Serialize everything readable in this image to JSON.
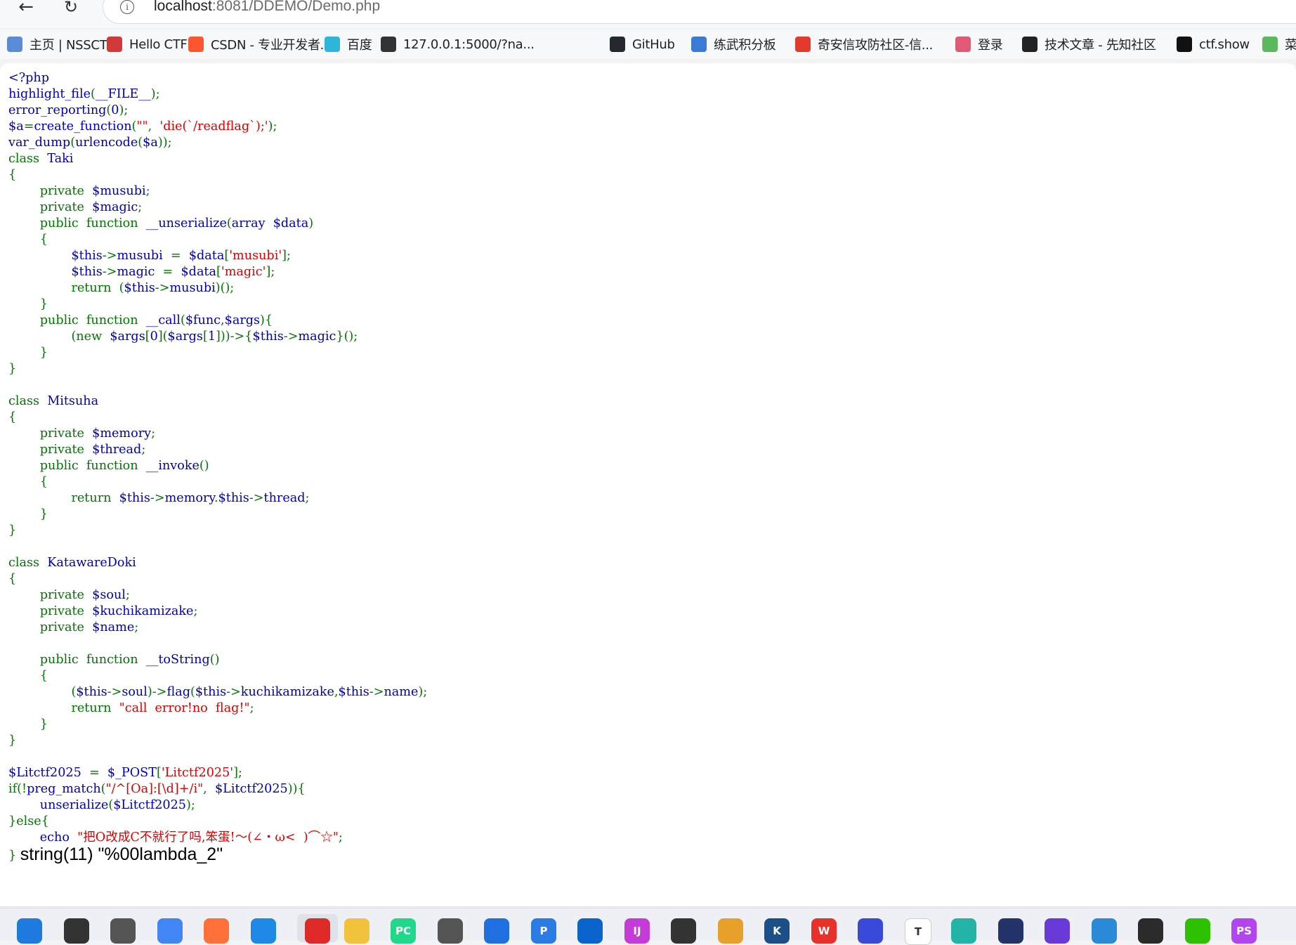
{
  "browser": {
    "url_host": "localhost",
    "url_path": ":8081/DDEMO/Demo.php",
    "bookmarks": [
      {
        "label": "主页 | NSSCTF",
        "icon": "nssctf-icon",
        "color": "#5b8bd6"
      },
      {
        "label": "Hello CTF",
        "icon": "hello-ctf-icon",
        "color": "#d03a3a"
      },
      {
        "label": "CSDN - 专业开发者...",
        "icon": "csdn-icon",
        "color": "#fc5531"
      },
      {
        "label": "百度",
        "icon": "baidu-icon",
        "color": "#2fb5d9"
      },
      {
        "label": "127.0.0.1:5000/?na...",
        "icon": "globe-icon",
        "color": "#333333"
      },
      {
        "label": "GitHub",
        "icon": "github-icon",
        "color": "#24292f"
      },
      {
        "label": "练武积分板",
        "icon": "scoreboard-icon",
        "color": "#3a7bd5"
      },
      {
        "label": "奇安信攻防社区-信...",
        "icon": "qianxin-icon",
        "color": "#e23b2e"
      },
      {
        "label": "登录",
        "icon": "login-icon",
        "color": "#e05a78"
      },
      {
        "label": "技术文章 - 先知社区",
        "icon": "xianzhi-icon",
        "color": "#222222"
      },
      {
        "label": "ctf.show",
        "icon": "ctfshow-icon",
        "color": "#111111"
      },
      {
        "label": "菜",
        "icon": "runoob-icon",
        "color": "#5cb85c"
      }
    ]
  },
  "code_lines": [
    [
      [
        "<?php",
        "df"
      ]
    ],
    [
      [
        "highlight_file",
        "df"
      ],
      [
        "(",
        "kw"
      ],
      [
        "__FILE__",
        "df"
      ],
      [
        ");",
        "kw"
      ]
    ],
    [
      [
        "error_reporting",
        "df"
      ],
      [
        "(",
        "kw"
      ],
      [
        "0",
        "df"
      ],
      [
        ");",
        "kw"
      ]
    ],
    [
      [
        "$a",
        "df"
      ],
      [
        "=",
        "kw"
      ],
      [
        "create_function",
        "df"
      ],
      [
        "(",
        "kw"
      ],
      [
        "\"\"",
        "st"
      ],
      [
        ",  ",
        "kw"
      ],
      [
        "'die(`/readflag`);'",
        "st"
      ],
      [
        ");",
        "kw"
      ]
    ],
    [
      [
        "var_dump",
        "df"
      ],
      [
        "(",
        "kw"
      ],
      [
        "urlencode",
        "df"
      ],
      [
        "(",
        "kw"
      ],
      [
        "$a",
        "df"
      ],
      [
        "));",
        "kw"
      ]
    ],
    [
      [
        "class  ",
        "kw"
      ],
      [
        "Taki",
        "df"
      ]
    ],
    [
      [
        "{",
        "kw"
      ]
    ],
    [
      [
        "        private  ",
        "kw"
      ],
      [
        "$musubi",
        "df"
      ],
      [
        ";",
        "kw"
      ]
    ],
    [
      [
        "        private  ",
        "kw"
      ],
      [
        "$magic",
        "df"
      ],
      [
        ";",
        "kw"
      ]
    ],
    [
      [
        "        public  function  ",
        "kw"
      ],
      [
        "__unserialize",
        "df"
      ],
      [
        "(",
        "kw"
      ],
      [
        "array  ",
        "df"
      ],
      [
        "$data",
        "df"
      ],
      [
        ")",
        "kw"
      ]
    ],
    [
      [
        "        {",
        "kw"
      ]
    ],
    [
      [
        "                ",
        "kw"
      ],
      [
        "$this",
        "df"
      ],
      [
        "->",
        "kw"
      ],
      [
        "musubi  ",
        "df"
      ],
      [
        "=  ",
        "kw"
      ],
      [
        "$data",
        "df"
      ],
      [
        "[",
        "kw"
      ],
      [
        "'musubi'",
        "st"
      ],
      [
        "];",
        "kw"
      ]
    ],
    [
      [
        "                ",
        "kw"
      ],
      [
        "$this",
        "df"
      ],
      [
        "->",
        "kw"
      ],
      [
        "magic  ",
        "df"
      ],
      [
        "=  ",
        "kw"
      ],
      [
        "$data",
        "df"
      ],
      [
        "[",
        "kw"
      ],
      [
        "'magic'",
        "st"
      ],
      [
        "];",
        "kw"
      ]
    ],
    [
      [
        "                return  (",
        "kw"
      ],
      [
        "$this",
        "df"
      ],
      [
        "->",
        "kw"
      ],
      [
        "musubi",
        "df"
      ],
      [
        ")();",
        "kw"
      ]
    ],
    [
      [
        "        }",
        "kw"
      ]
    ],
    [
      [
        "        public  function  ",
        "kw"
      ],
      [
        "__call",
        "df"
      ],
      [
        "(",
        "kw"
      ],
      [
        "$func",
        "df"
      ],
      [
        ",",
        "kw"
      ],
      [
        "$args",
        "df"
      ],
      [
        "){",
        "kw"
      ]
    ],
    [
      [
        "                (new  ",
        "kw"
      ],
      [
        "$args",
        "df"
      ],
      [
        "[",
        "kw"
      ],
      [
        "0",
        "df"
      ],
      [
        "](",
        "kw"
      ],
      [
        "$args",
        "df"
      ],
      [
        "[",
        "kw"
      ],
      [
        "1",
        "df"
      ],
      [
        "]))->{",
        "kw"
      ],
      [
        "$this",
        "df"
      ],
      [
        "->",
        "kw"
      ],
      [
        "magic",
        "df"
      ],
      [
        "}();",
        "kw"
      ]
    ],
    [
      [
        "        }",
        "kw"
      ]
    ],
    [
      [
        "}",
        "kw"
      ]
    ],
    [
      [
        "",
        "kw"
      ]
    ],
    [
      [
        "class  ",
        "kw"
      ],
      [
        "Mitsuha",
        "df"
      ]
    ],
    [
      [
        "{",
        "kw"
      ]
    ],
    [
      [
        "        private  ",
        "kw"
      ],
      [
        "$memory",
        "df"
      ],
      [
        ";",
        "kw"
      ]
    ],
    [
      [
        "        private  ",
        "kw"
      ],
      [
        "$thread",
        "df"
      ],
      [
        ";",
        "kw"
      ]
    ],
    [
      [
        "        public  function  ",
        "kw"
      ],
      [
        "__invoke",
        "df"
      ],
      [
        "()",
        "kw"
      ]
    ],
    [
      [
        "        {",
        "kw"
      ]
    ],
    [
      [
        "                return  ",
        "kw"
      ],
      [
        "$this",
        "df"
      ],
      [
        "->",
        "kw"
      ],
      [
        "memory",
        "df"
      ],
      [
        ".",
        "kw"
      ],
      [
        "$this",
        "df"
      ],
      [
        "->",
        "kw"
      ],
      [
        "thread",
        "df"
      ],
      [
        ";",
        "kw"
      ]
    ],
    [
      [
        "        }",
        "kw"
      ]
    ],
    [
      [
        "}",
        "kw"
      ]
    ],
    [
      [
        "",
        "kw"
      ]
    ],
    [
      [
        "class  ",
        "kw"
      ],
      [
        "KatawareDoki",
        "df"
      ]
    ],
    [
      [
        "{",
        "kw"
      ]
    ],
    [
      [
        "        private  ",
        "kw"
      ],
      [
        "$soul",
        "df"
      ],
      [
        ";",
        "kw"
      ]
    ],
    [
      [
        "        private  ",
        "kw"
      ],
      [
        "$kuchikamizake",
        "df"
      ],
      [
        ";",
        "kw"
      ]
    ],
    [
      [
        "        private  ",
        "kw"
      ],
      [
        "$name",
        "df"
      ],
      [
        ";",
        "kw"
      ]
    ],
    [
      [
        "",
        "kw"
      ]
    ],
    [
      [
        "        public  function  ",
        "kw"
      ],
      [
        "__toString",
        "df"
      ],
      [
        "()",
        "kw"
      ]
    ],
    [
      [
        "        {",
        "kw"
      ]
    ],
    [
      [
        "                (",
        "kw"
      ],
      [
        "$this",
        "df"
      ],
      [
        "->",
        "kw"
      ],
      [
        "soul",
        "df"
      ],
      [
        ")->",
        "kw"
      ],
      [
        "flag",
        "df"
      ],
      [
        "(",
        "kw"
      ],
      [
        "$this",
        "df"
      ],
      [
        "->",
        "kw"
      ],
      [
        "kuchikamizake",
        "df"
      ],
      [
        ",",
        "kw"
      ],
      [
        "$this",
        "df"
      ],
      [
        "->",
        "kw"
      ],
      [
        "name",
        "df"
      ],
      [
        ");",
        "kw"
      ]
    ],
    [
      [
        "                return  ",
        "kw"
      ],
      [
        "\"call  error!no  flag!\"",
        "st"
      ],
      [
        ";",
        "kw"
      ]
    ],
    [
      [
        "        }",
        "kw"
      ]
    ],
    [
      [
        "}",
        "kw"
      ]
    ],
    [
      [
        "",
        "kw"
      ]
    ],
    [
      [
        "$Litctf2025  ",
        "df"
      ],
      [
        "=  ",
        "kw"
      ],
      [
        "$_POST",
        "df"
      ],
      [
        "[",
        "kw"
      ],
      [
        "'Litctf2025'",
        "st"
      ],
      [
        "];",
        "kw"
      ]
    ],
    [
      [
        "if(!",
        "kw"
      ],
      [
        "preg_match",
        "df"
      ],
      [
        "(",
        "kw"
      ],
      [
        "\"/^[Oa]:[\\d]+/i\"",
        "st"
      ],
      [
        ",  ",
        "kw"
      ],
      [
        "$Litctf2025",
        "df"
      ],
      [
        "))",
        "kw"
      ],
      [
        "{",
        "kw"
      ]
    ],
    [
      [
        "        ",
        "kw"
      ],
      [
        "unserialize",
        "df"
      ],
      [
        "(",
        "kw"
      ],
      [
        "$Litctf2025",
        "df"
      ],
      [
        ");",
        "kw"
      ]
    ],
    [
      [
        "}else{",
        "kw"
      ]
    ],
    [
      [
        "        echo  ",
        "df"
      ],
      [
        "\"把O改成C不就行了吗,笨蛋!～(∠・ω<  )⌒☆\"",
        "st"
      ],
      [
        ";",
        "kw"
      ]
    ],
    [
      [
        "} ",
        "kw"
      ]
    ]
  ],
  "var_dump_output": "string(11) \"%00lambda_2\"",
  "taskbar": [
    {
      "icon": "windows-start-icon",
      "color": "#1f7ae0",
      "label": ""
    },
    {
      "icon": "search-icon",
      "color": "#333333",
      "label": ""
    },
    {
      "icon": "task-view-icon",
      "color": "#555555",
      "label": ""
    },
    {
      "icon": "chrome-icon",
      "color": "#4285f4",
      "label": ""
    },
    {
      "icon": "firefox-icon",
      "color": "#ff7139",
      "label": ""
    },
    {
      "icon": "vscode-icon",
      "color": "#1e88e5",
      "label": ""
    },
    {
      "icon": "netease-music-icon",
      "color": "#e02a2a",
      "label": ""
    },
    {
      "icon": "file-explorer-icon",
      "color": "#f2c23c",
      "label": ""
    },
    {
      "icon": "pycharm-icon",
      "color": "#21d789",
      "label": "PC"
    },
    {
      "icon": "burp-icon",
      "color": "#555555",
      "label": ""
    },
    {
      "icon": "feishu-icon",
      "color": "#1f6fe0",
      "label": ""
    },
    {
      "icon": "p-app-icon",
      "color": "#2a7be4",
      "label": "P"
    },
    {
      "icon": "edge-blue-icon",
      "color": "#0b63ce",
      "label": ""
    },
    {
      "icon": "intellij-icon",
      "color": "#c43bd8",
      "label": "IJ"
    },
    {
      "icon": "penguin-icon",
      "color": "#333333",
      "label": ""
    },
    {
      "icon": "wireshark-icon",
      "color": "#e8a02a",
      "label": ""
    },
    {
      "icon": "k-app-icon",
      "color": "#1b4f86",
      "label": "K"
    },
    {
      "icon": "wps-icon",
      "color": "#e8312a",
      "label": "W"
    },
    {
      "icon": "headphones-icon",
      "color": "#3a4ad8",
      "label": ""
    },
    {
      "icon": "typora-icon",
      "color": "#ffffff",
      "label": "T"
    },
    {
      "icon": "edge-icon",
      "color": "#23b3a7",
      "label": ""
    },
    {
      "icon": "cat-icon",
      "color": "#24336a",
      "label": ""
    },
    {
      "icon": "bolt-app-icon",
      "color": "#6a3ad8",
      "label": ""
    },
    {
      "icon": "vmware-icon",
      "color": "#2a8ad8",
      "label": ""
    },
    {
      "icon": "terminal-icon",
      "color": "#2b2b2b",
      "label": ""
    },
    {
      "icon": "wechat-icon",
      "color": "#2dc100",
      "label": ""
    },
    {
      "icon": "phpstorm-icon",
      "color": "#b345f1",
      "label": "PS"
    }
  ]
}
